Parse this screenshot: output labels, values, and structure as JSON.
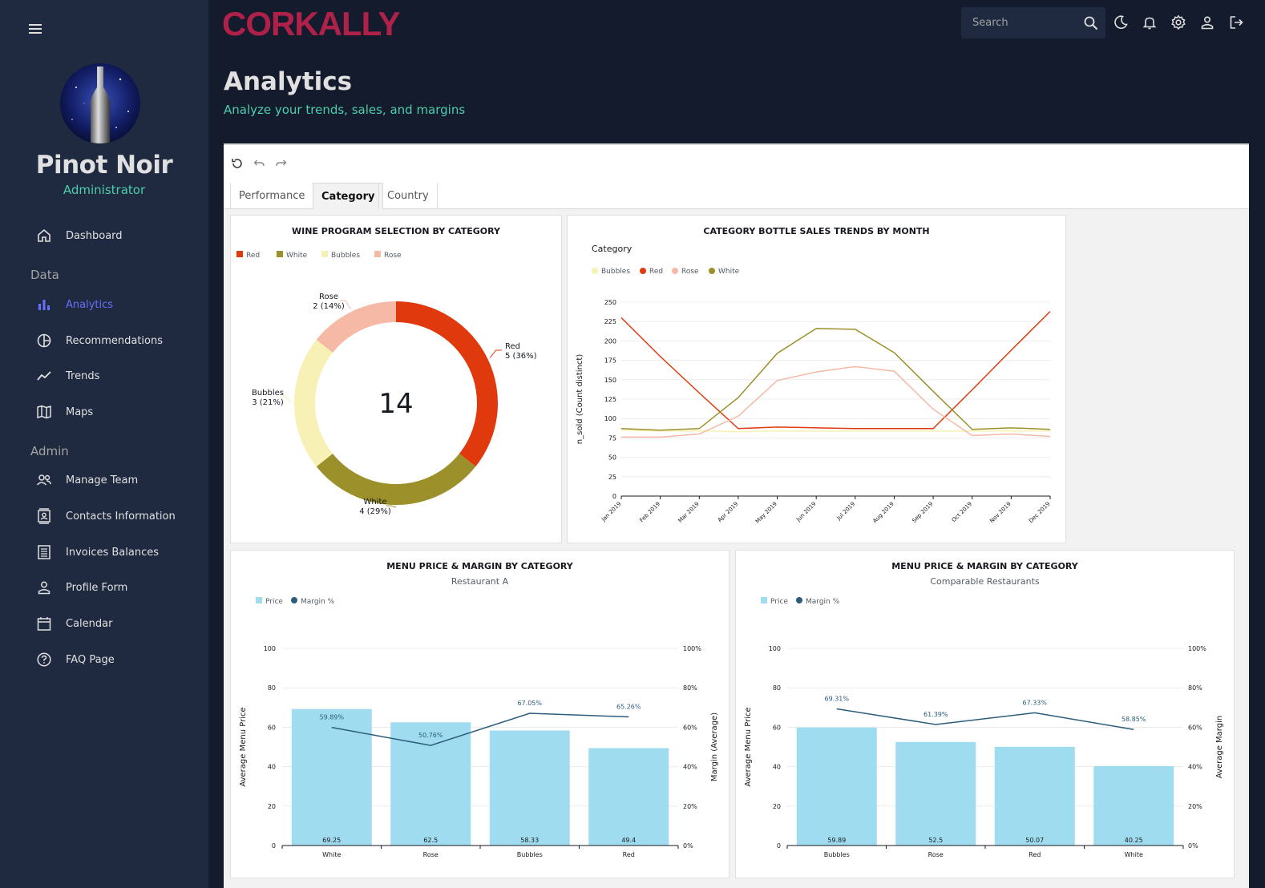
{
  "user": {
    "name": "Pinot Noir",
    "role": "Administrator"
  },
  "brand": {
    "logo": "CORKALLY",
    "color": "#b0214a"
  },
  "nav": {
    "dashboard": "Dashboard",
    "section_data": "Data",
    "analytics": "Analytics",
    "recommendations": "Recommendations",
    "trends": "Trends",
    "maps": "Maps",
    "section_admin": "Admin",
    "manage_team": "Manage Team",
    "contacts": "Contacts Information",
    "invoices": "Invoices Balances",
    "profile_form": "Profile Form",
    "calendar": "Calendar",
    "faq": "FAQ Page"
  },
  "search": {
    "placeholder": "Search"
  },
  "header": {
    "title": "Analytics",
    "subtitle": "Analyze your trends, sales, and margins"
  },
  "tabs": [
    "Performance",
    "Category",
    "Country"
  ],
  "chart_data": [
    {
      "type": "pie",
      "title": "WINE PROGRAM SELECTION BY CATEGORY",
      "center_label": "14",
      "legend": [
        "Red",
        "White",
        "Bubbles",
        "Rose"
      ],
      "legend_placement": "top-left",
      "slices": [
        {
          "name": "Red",
          "value": 5,
          "label": "5 (36%)",
          "color": "#e0390e"
        },
        {
          "name": "White",
          "value": 4,
          "label": "4 (29%)",
          "color": "#9b9029"
        },
        {
          "name": "Bubbles",
          "value": 3,
          "label": "3 (21%)",
          "color": "#f7f1b6"
        },
        {
          "name": "Rose",
          "value": 2,
          "label": "2 (14%)",
          "color": "#f5b9a5"
        }
      ]
    },
    {
      "type": "line",
      "title": "CATEGORY BOTTLE SALES TRENDS BY MONTH",
      "legend_title": "Category",
      "ylabel": "n_sold (Count distinct)",
      "ylim": [
        0,
        250
      ],
      "yticks": [
        0,
        25,
        50,
        75,
        100,
        125,
        150,
        175,
        200,
        225,
        250
      ],
      "x": [
        "Jan 2019",
        "Feb 2019",
        "Mar 2019",
        "Apr 2019",
        "May 2019",
        "Jun 2019",
        "Jul 2019",
        "Aug 2019",
        "Sep 2019",
        "Oct 2019",
        "Nov 2019",
        "Dec 2019"
      ],
      "series": [
        {
          "name": "Bubbles",
          "color": "#f7f1b6",
          "values": [
            85,
            84,
            84,
            83,
            84,
            84,
            84,
            84,
            84,
            84,
            84,
            84
          ]
        },
        {
          "name": "Red",
          "color": "#e0390e",
          "values": [
            230,
            180,
            133,
            87,
            89,
            88,
            87,
            87,
            87,
            137,
            188,
            238
          ]
        },
        {
          "name": "Rose",
          "color": "#f5b9a5",
          "values": [
            76,
            76,
            80,
            103,
            149,
            160,
            167,
            161,
            112,
            78,
            80,
            77
          ]
        },
        {
          "name": "White",
          "color": "#9b9029",
          "values": [
            87,
            85,
            87,
            127,
            184,
            216,
            215,
            185,
            135,
            86,
            88,
            86
          ]
        }
      ]
    },
    {
      "type": "bar",
      "title": "MENU PRICE & MARGIN BY CATEGORY",
      "subtitle": "Restaurant A",
      "legend": [
        "Price",
        "Margin %"
      ],
      "ylabel": "Average Menu Price",
      "y2label": "Margin (Average)",
      "ylim": [
        0,
        100
      ],
      "yticks": [
        0,
        20,
        40,
        60,
        80,
        100
      ],
      "y2ticks": [
        "0%",
        "20%",
        "40%",
        "60%",
        "80%",
        "100%"
      ],
      "categories": [
        "White",
        "Rose",
        "Bubbles",
        "Red"
      ],
      "series": [
        {
          "name": "Price",
          "type": "bar",
          "color": "#a0dcef",
          "values": [
            69.25,
            62.5,
            58.33,
            49.4
          ],
          "labels": [
            "69.25",
            "62.5",
            "58.33",
            "49.4"
          ]
        },
        {
          "name": "Margin %",
          "type": "line",
          "color": "#2c5d7c",
          "values": [
            59.89,
            50.76,
            67.05,
            65.26
          ],
          "labels": [
            "59.89%",
            "50.76%",
            "67.05%",
            "65.26%"
          ]
        }
      ]
    },
    {
      "type": "bar",
      "title": "MENU PRICE & MARGIN BY CATEGORY",
      "subtitle": "Comparable Restaurants",
      "legend": [
        "Price",
        "Margin %"
      ],
      "ylabel": "Average Menu Price",
      "y2label": "Average Margin",
      "ylim": [
        0,
        100
      ],
      "yticks": [
        0,
        20,
        40,
        60,
        80,
        100
      ],
      "y2ticks": [
        "0%",
        "20%",
        "40%",
        "60%",
        "80%",
        "100%"
      ],
      "categories": [
        "Bubbles",
        "Rose",
        "Red",
        "White"
      ],
      "series": [
        {
          "name": "Price",
          "type": "bar",
          "color": "#a0dcef",
          "values": [
            59.89,
            52.5,
            50.07,
            40.25
          ],
          "labels": [
            "59.89",
            "52.5",
            "50.07",
            "40.25"
          ]
        },
        {
          "name": "Margin %",
          "type": "line",
          "color": "#2c5d7c",
          "values": [
            69.31,
            61.39,
            67.33,
            58.85
          ],
          "labels": [
            "69.31%",
            "61.39%",
            "67.33%",
            "58.85%"
          ]
        }
      ]
    }
  ]
}
